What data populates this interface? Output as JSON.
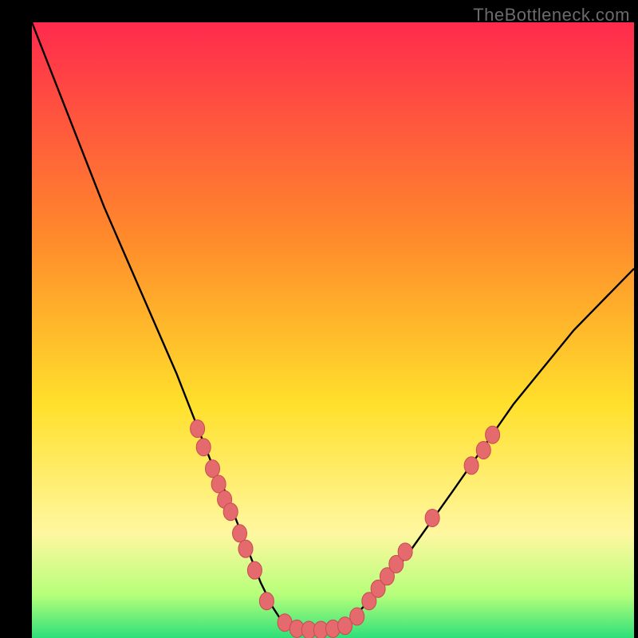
{
  "watermark": "TheBottleneck.com",
  "colors": {
    "bg": "#000000",
    "gradient_top": "#ff2a4d",
    "gradient_mid_upper": "#ff8a2b",
    "gradient_mid": "#ffe02b",
    "gradient_lower": "#fff7a0",
    "gradient_green1": "#b6ff7a",
    "gradient_green2": "#2ee07a",
    "curve_stroke": "#000000",
    "marker_fill": "#e46a6d",
    "marker_stroke": "#c94a52"
  },
  "chart_data": {
    "type": "line",
    "title": "",
    "xlabel": "",
    "ylabel": "",
    "xlim": [
      0,
      100
    ],
    "ylim": [
      0,
      100
    ],
    "series": [
      {
        "name": "bottleneck-curve",
        "x": [
          0,
          4,
          8,
          12,
          16,
          20,
          24,
          28,
          30,
          32,
          34,
          36,
          38,
          40,
          42,
          44,
          46,
          48,
          52,
          56,
          62,
          70,
          80,
          90,
          100
        ],
        "y": [
          100,
          90,
          80,
          70,
          61,
          52,
          43,
          33,
          28,
          24,
          19,
          14,
          9,
          5,
          2,
          1,
          1,
          1,
          2,
          6,
          13,
          24,
          38,
          50,
          60
        ]
      }
    ],
    "markers": {
      "name": "sample-points",
      "points": [
        {
          "x": 27.5,
          "y": 34
        },
        {
          "x": 28.5,
          "y": 31
        },
        {
          "x": 30,
          "y": 27.5
        },
        {
          "x": 31,
          "y": 25
        },
        {
          "x": 32,
          "y": 22.5
        },
        {
          "x": 33,
          "y": 20.5
        },
        {
          "x": 34.5,
          "y": 17
        },
        {
          "x": 35.5,
          "y": 14.5
        },
        {
          "x": 37,
          "y": 11
        },
        {
          "x": 39,
          "y": 6
        },
        {
          "x": 42,
          "y": 2.5
        },
        {
          "x": 44,
          "y": 1.5
        },
        {
          "x": 46,
          "y": 1.3
        },
        {
          "x": 48,
          "y": 1.3
        },
        {
          "x": 50,
          "y": 1.5
        },
        {
          "x": 52,
          "y": 2
        },
        {
          "x": 54,
          "y": 3.5
        },
        {
          "x": 56,
          "y": 6
        },
        {
          "x": 57.5,
          "y": 8
        },
        {
          "x": 59,
          "y": 10
        },
        {
          "x": 60.5,
          "y": 12
        },
        {
          "x": 62,
          "y": 14
        },
        {
          "x": 66.5,
          "y": 19.5
        },
        {
          "x": 73,
          "y": 28
        },
        {
          "x": 75,
          "y": 30.5
        },
        {
          "x": 76.5,
          "y": 33
        }
      ]
    }
  }
}
